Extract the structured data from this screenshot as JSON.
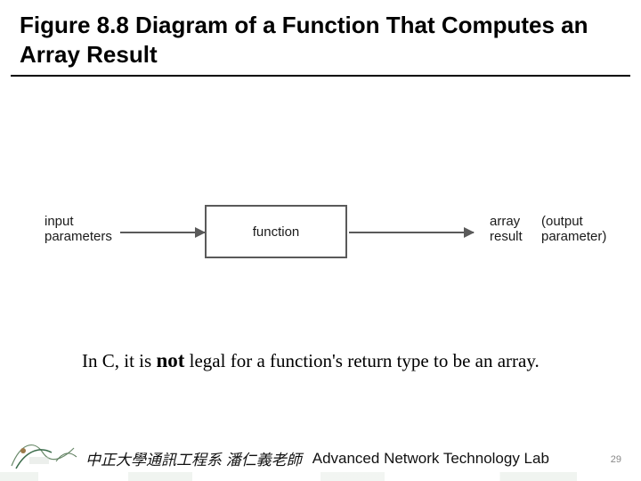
{
  "title": {
    "prefix": "Figure 8.8",
    "rest": "  Diagram of a Function That Computes an Array Result"
  },
  "diagram": {
    "input_label_line1": "input",
    "input_label_line2": "parameters",
    "function_label": "function",
    "array_label_line1": "array",
    "array_label_line2": "result",
    "output_label_line1": "(output",
    "output_label_line2": "parameter)"
  },
  "caption": {
    "pre": "In C, it is ",
    "emph": "not",
    "post": " legal for a function's return type to be an array."
  },
  "footer": {
    "cjk": "中正大學通訊工程系 潘仁義老師",
    "lab": "Advanced Network Technology Lab"
  },
  "page_number": "29",
  "chart_data": {
    "type": "diagram",
    "title": "Diagram of a Function That Computes an Array Result",
    "nodes": [
      {
        "id": "input",
        "label": "input parameters"
      },
      {
        "id": "function",
        "label": "function",
        "shape": "box"
      },
      {
        "id": "output",
        "label": "array result (output parameter)"
      }
    ],
    "edges": [
      {
        "from": "input",
        "to": "function",
        "style": "arrow"
      },
      {
        "from": "function",
        "to": "output",
        "style": "arrow"
      }
    ],
    "note": "In C, it is not legal for a function's return type to be an array."
  }
}
